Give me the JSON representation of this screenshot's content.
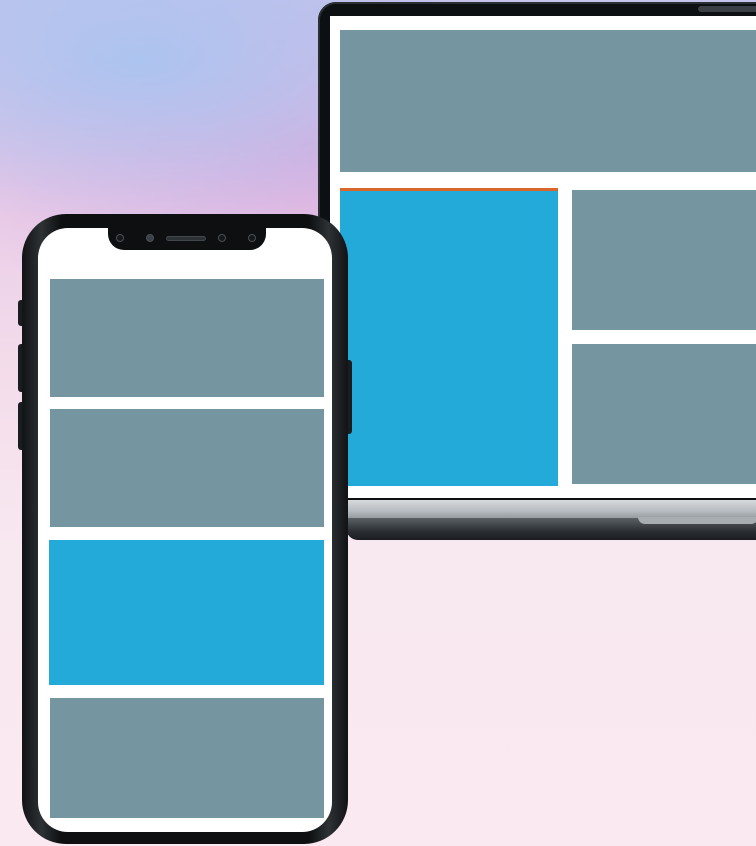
{
  "colors": {
    "placeholder_gray": "#7595a1",
    "accent_blue": "#24aad9",
    "accent_orange": "#d9662a",
    "screen_white": "#ffffff",
    "device_black": "#0d0f10"
  },
  "devices": {
    "laptop": {
      "screen_blocks": [
        "hero-block",
        "feature-block",
        "card-block-1",
        "card-block-2"
      ]
    },
    "phone": {
      "screen_blocks": [
        "card-block-1",
        "card-block-2",
        "feature-block",
        "card-block-3"
      ]
    }
  }
}
